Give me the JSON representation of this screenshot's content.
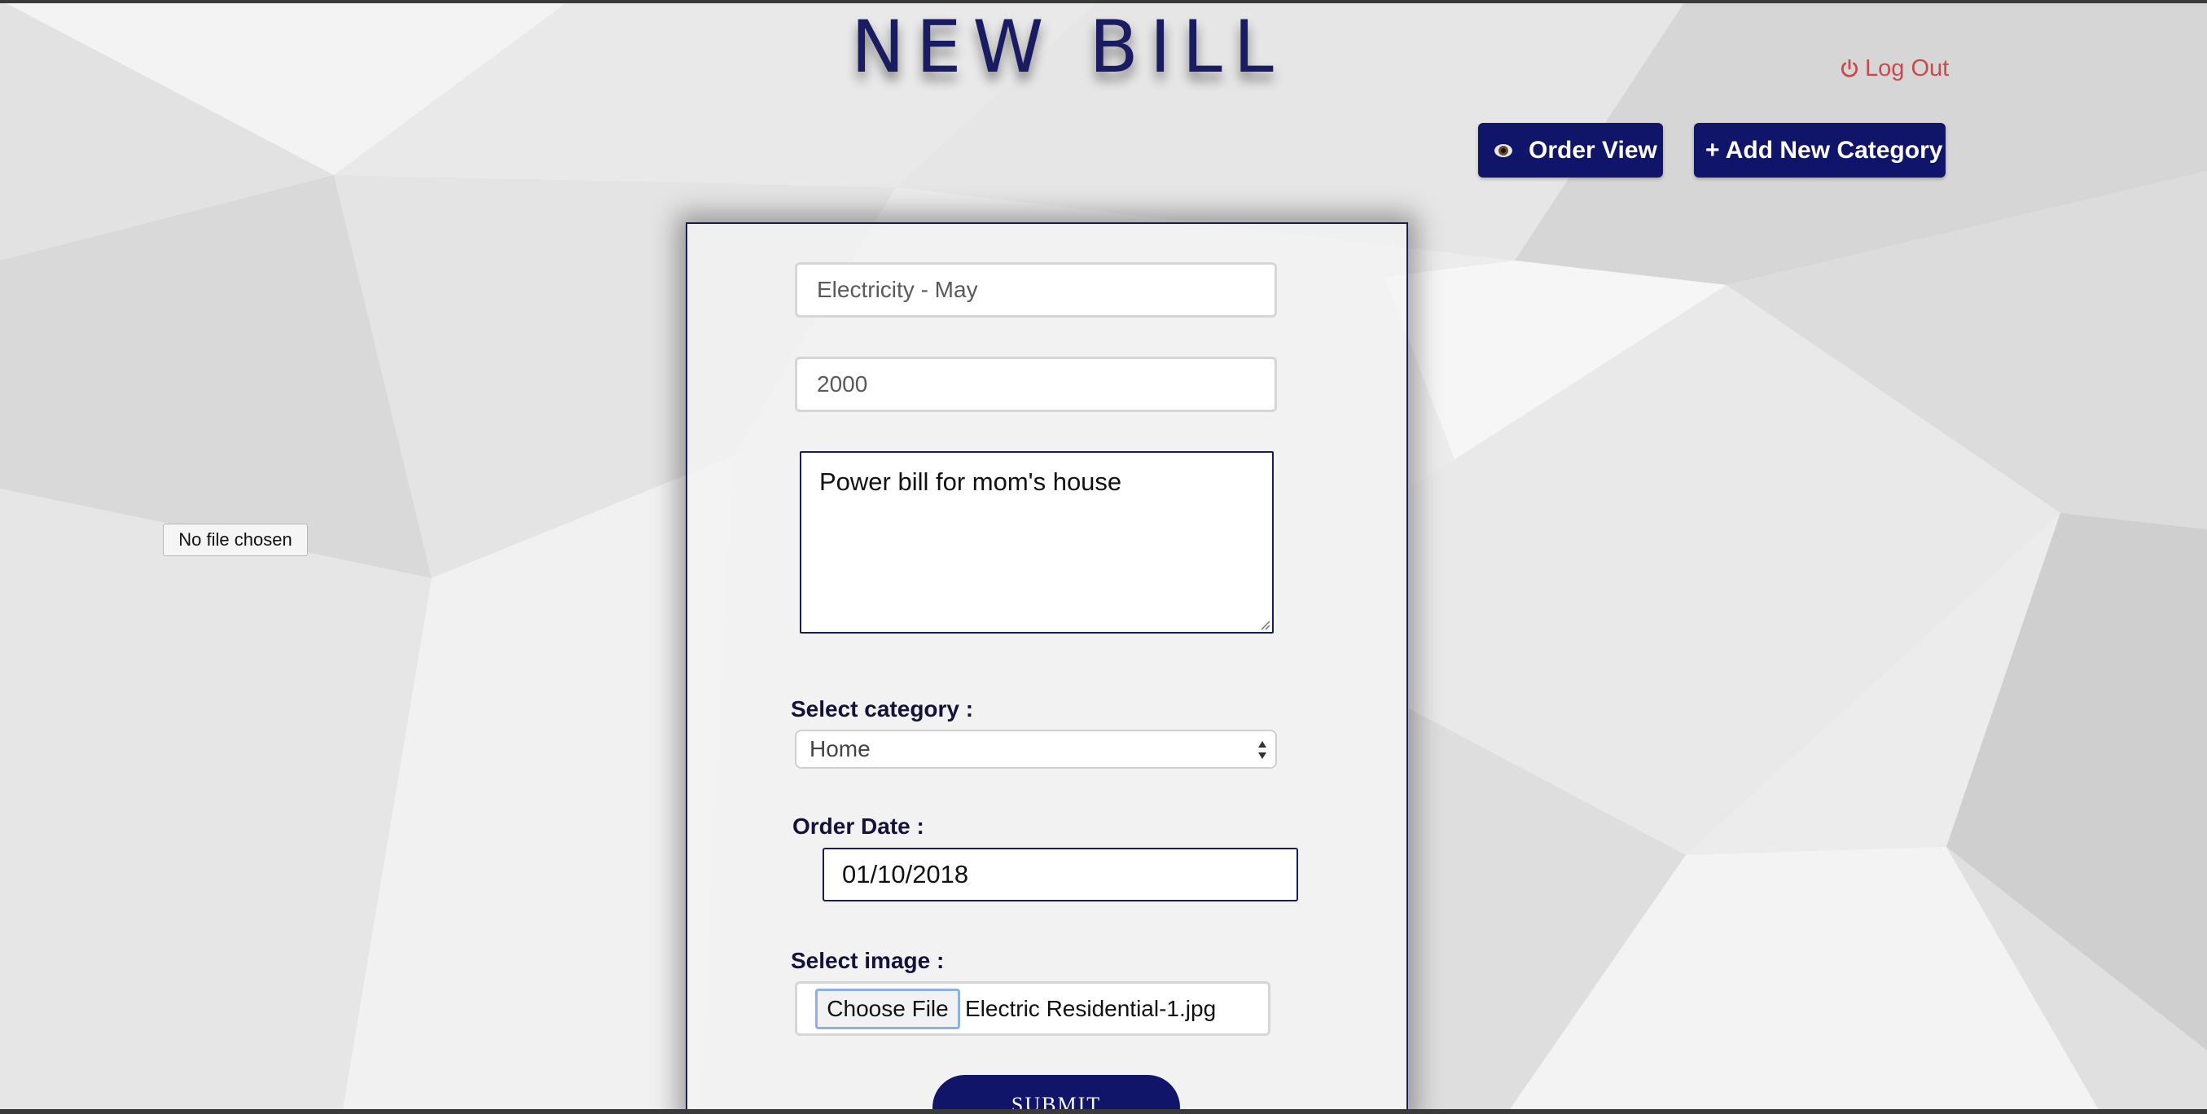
{
  "page": {
    "title": "NEW BILL"
  },
  "header": {
    "logout_label": "Log Out",
    "order_view_label": "Order View",
    "add_category_label": "+ Add New Category"
  },
  "stray_file_status": "No file chosen",
  "form": {
    "name_value": "Electricity - May",
    "amount_value": "2000",
    "description_value": "Power bill for mom's house",
    "category_label": "Select category :",
    "category_value": "Home",
    "date_label": "Order Date :",
    "date_value": "01/10/2018",
    "image_label": "Select image :",
    "choose_file_label": "Choose File",
    "file_name": "Electric Residential-1.jpg",
    "submit_label": "SUBMIT"
  },
  "icons": {
    "logout": "power-icon",
    "order_view": "eye-icon",
    "select": "select-arrows-icon"
  },
  "colors": {
    "accent": "#10156a",
    "title": "#1a1c62",
    "logout": "#c94a4a",
    "background": "#ececec"
  }
}
